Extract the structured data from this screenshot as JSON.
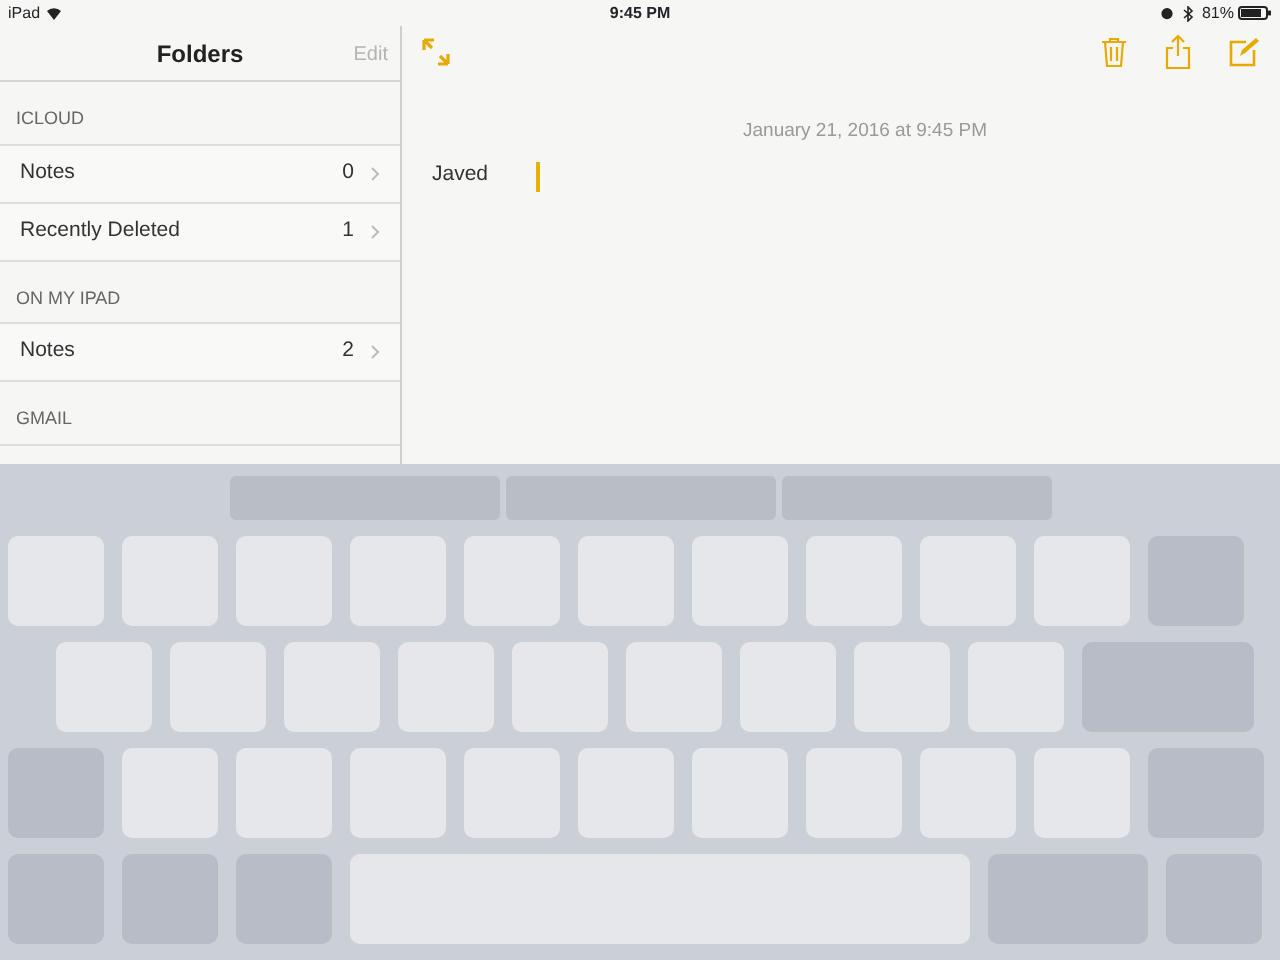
{
  "status_bar": {
    "device": "iPad",
    "time": "9:45 PM",
    "battery": "81%"
  },
  "sidebar": {
    "title": "Folders",
    "edit": {
      "label": "Edit",
      "disabled": true
    },
    "sections": [
      {
        "header": "ICLOUD",
        "items": [
          {
            "label": "Notes",
            "count": "0"
          },
          {
            "label": "Recently Deleted",
            "count": "1"
          }
        ]
      },
      {
        "header": "ON MY IPAD",
        "items": [
          {
            "label": "Notes",
            "count": "2"
          }
        ]
      },
      {
        "header": "GMAIL"
      }
    ]
  },
  "note": {
    "date": "January 21, 2016 at 9:45 PM",
    "text": "Javed"
  },
  "keyboard": {
    "rows": [
      {
        "keys": [
          {
            "kind": "letter"
          },
          {
            "kind": "letter"
          },
          {
            "kind": "letter"
          },
          {
            "kind": "letter"
          },
          {
            "kind": "letter"
          },
          {
            "kind": "letter"
          },
          {
            "kind": "letter"
          },
          {
            "kind": "letter"
          },
          {
            "kind": "letter"
          },
          {
            "kind": "letter"
          },
          {
            "kind": "modifier"
          }
        ]
      },
      {
        "keys": [
          {
            "kind": "letter"
          },
          {
            "kind": "letter"
          },
          {
            "kind": "letter"
          },
          {
            "kind": "letter"
          },
          {
            "kind": "letter"
          },
          {
            "kind": "letter"
          },
          {
            "kind": "letter"
          },
          {
            "kind": "letter"
          },
          {
            "kind": "letter"
          },
          {
            "kind": "return"
          }
        ]
      },
      {
        "keys": [
          {
            "kind": "modifier"
          },
          {
            "kind": "letter"
          },
          {
            "kind": "letter"
          },
          {
            "kind": "letter"
          },
          {
            "kind": "letter"
          },
          {
            "kind": "letter"
          },
          {
            "kind": "letter"
          },
          {
            "kind": "letter"
          },
          {
            "kind": "letter"
          },
          {
            "kind": "letter"
          },
          {
            "kind": "shift"
          }
        ]
      },
      {
        "keys": [
          {
            "kind": "modifier"
          },
          {
            "kind": "modifier"
          },
          {
            "kind": "modifier"
          },
          {
            "kind": "space"
          },
          {
            "kind": "wide"
          },
          {
            "kind": "modifier"
          }
        ]
      }
    ]
  }
}
